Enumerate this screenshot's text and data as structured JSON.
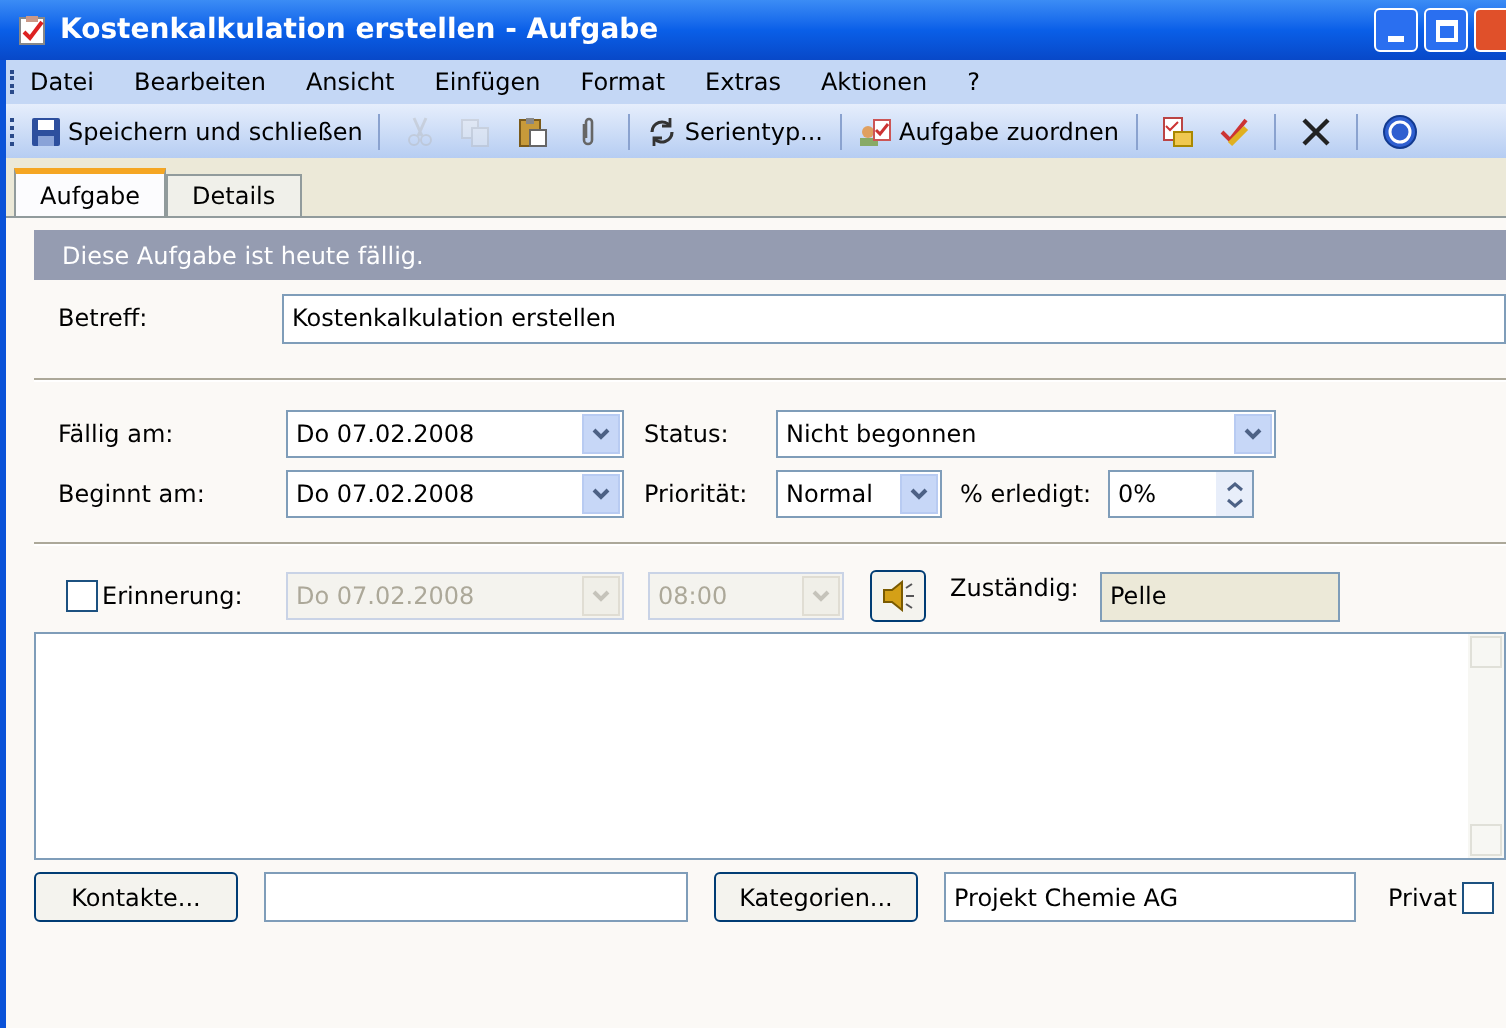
{
  "window": {
    "title": "Kostenkalkulation erstellen - Aufgabe"
  },
  "menu": [
    "Datei",
    "Bearbeiten",
    "Ansicht",
    "Einfügen",
    "Format",
    "Extras",
    "Aktionen",
    "?"
  ],
  "toolbar": [
    {
      "kind": "button",
      "label": "Speichern und schließen",
      "disabled": false
    },
    {
      "kind": "separator"
    },
    {
      "kind": "icon",
      "disabled": true
    },
    {
      "kind": "icon",
      "disabled": true
    },
    {
      "kind": "icon",
      "disabled": false
    },
    {
      "kind": "icon",
      "disabled": false
    },
    {
      "kind": "separator"
    },
    {
      "kind": "button",
      "label": "Serientyp...",
      "disabled": false
    },
    {
      "kind": "separator"
    },
    {
      "kind": "button",
      "label": "Aufgabe zuordnen",
      "disabled": false
    },
    {
      "kind": "separator"
    },
    {
      "kind": "icon",
      "disabled": false
    },
    {
      "kind": "icon",
      "disabled": false
    },
    {
      "kind": "separator"
    },
    {
      "kind": "icon",
      "disabled": false
    },
    {
      "kind": "separator"
    },
    {
      "kind": "icon",
      "disabled": false
    }
  ],
  "tabs": [
    {
      "label": "Aufgabe",
      "selected": true
    },
    {
      "label": "Details",
      "selected": false
    }
  ],
  "banner": "Diese Aufgabe ist heute fällig.",
  "subject": {
    "label": "Betreff:",
    "value": "Kostenkalkulation erstellen"
  },
  "due": {
    "label": "Fällig am:",
    "value": "Do 07.02.2008"
  },
  "start": {
    "label": "Beginnt am:",
    "value": "Do 07.02.2008"
  },
  "status": {
    "label": "Status:",
    "value": "Nicht begonnen"
  },
  "priority": {
    "label": "Priorität:",
    "value": "Normal"
  },
  "percent": {
    "label": "% erledigt:",
    "value": "0%"
  },
  "reminder": {
    "label": "Erinnerung:",
    "checked": false,
    "date": "Do 07.02.2008",
    "time": "08:00"
  },
  "owner": {
    "label": "Zuständig:",
    "value": "Pelle"
  },
  "contacts": {
    "button": "Kontakte..."
  },
  "categories": {
    "button": "Kategorien...",
    "value": "Projekt Chemie AG"
  },
  "private": {
    "label": "Privat",
    "checked": false
  }
}
